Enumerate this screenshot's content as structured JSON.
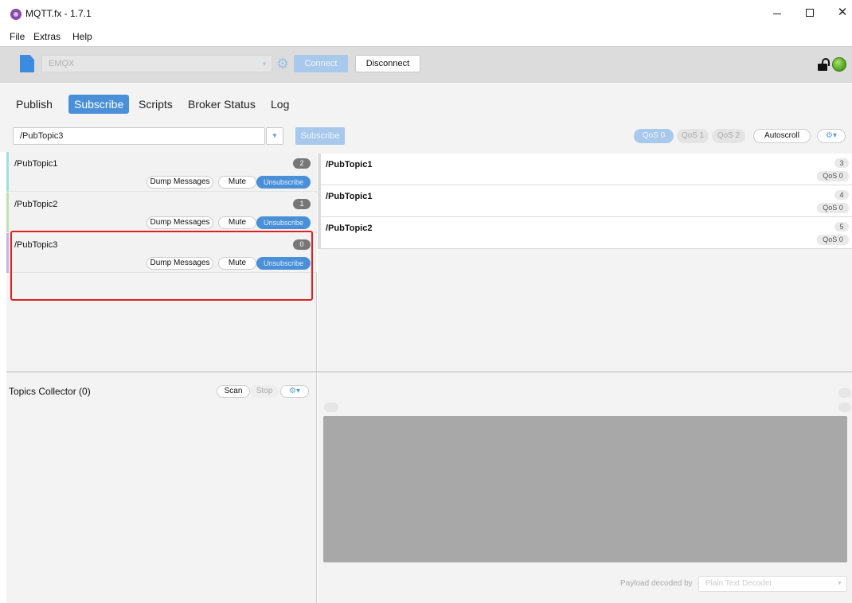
{
  "window": {
    "title": "MQTT.fx - 1.7.1",
    "minimize_glyph": "–",
    "maximize_glyph": "☐",
    "close_glyph": "✕"
  },
  "menu": [
    "File",
    "Extras",
    "Help"
  ],
  "toolbar": {
    "profile": "EMQX",
    "connect_label": "Connect",
    "disconnect_label": "Disconnect",
    "connection_status_color": "#5cb82a"
  },
  "tabs": [
    {
      "label": "Publish",
      "active": false
    },
    {
      "label": "Subscribe",
      "active": true
    },
    {
      "label": "Scripts",
      "active": false
    },
    {
      "label": "Broker Status",
      "active": false
    },
    {
      "label": "Log",
      "active": false
    }
  ],
  "subscribe_bar": {
    "topic_value": "/PubTopic3",
    "subscribe_label": "Subscribe",
    "qos_options": [
      "QoS 0",
      "QoS 1",
      "QoS 2"
    ],
    "selected_qos": "QoS 0",
    "autoscroll_label": "Autoscroll"
  },
  "subscriptions": [
    {
      "topic": "/PubTopic1",
      "count": "2",
      "color": "#9ee0e0"
    },
    {
      "topic": "/PubTopic2",
      "count": "1",
      "color": "#bfe3b0"
    },
    {
      "topic": "/PubTopic3",
      "count": "0",
      "color": "#c9b3e6"
    }
  ],
  "subscription_actions": {
    "dump": "Dump Messages",
    "mute": "Mute",
    "unsubscribe": "Unsubscribe"
  },
  "messages": [
    {
      "topic": "/PubTopic1",
      "index": "3",
      "qos": "QoS 0"
    },
    {
      "topic": "/PubTopic1",
      "index": "4",
      "qos": "QoS 0"
    },
    {
      "topic": "/PubTopic2",
      "index": "5",
      "qos": "QoS 0"
    }
  ],
  "collector": {
    "title": "Topics Collector (0)",
    "scan_label": "Scan",
    "stop_label": "Stop"
  },
  "detail": {
    "decoded_by_label": "Payload decoded by",
    "decoder": "Plain Text Decoder"
  },
  "colors": {
    "accent": "#4a90d9",
    "highlight_border": "#e02020",
    "payload_bg": "#a8a8a8"
  }
}
